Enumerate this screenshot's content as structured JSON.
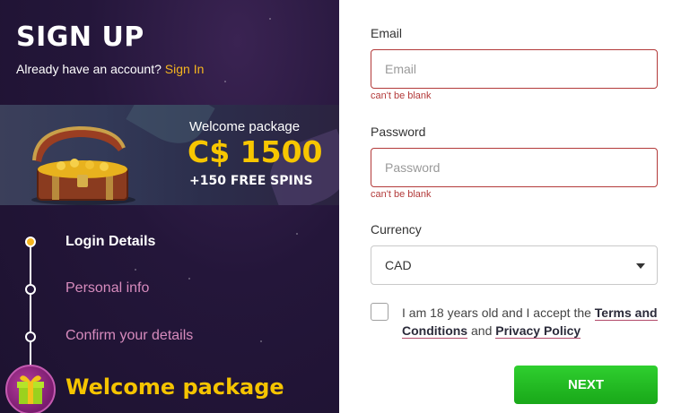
{
  "header": {
    "title": "SIGN UP",
    "have_account_text": "Already have an account?",
    "sign_in_link": "Sign In"
  },
  "banner": {
    "label": "Welcome package",
    "amount": "C$ 1500",
    "spins": "+150 FREE SPINS",
    "image_icon": "treasure-chest-icon"
  },
  "steps": [
    {
      "label": "Login Details",
      "state": "active"
    },
    {
      "label": "Personal info",
      "state": "pending"
    },
    {
      "label": "Confirm your details",
      "state": "pending"
    },
    {
      "label": "Welcome package",
      "state": "final",
      "icon": "gift-box-icon"
    }
  ],
  "form": {
    "email": {
      "label": "Email",
      "placeholder": "Email",
      "value": "",
      "error": "can't be blank"
    },
    "password": {
      "label": "Password",
      "placeholder": "Password",
      "value": "",
      "error": "can't be blank"
    },
    "currency": {
      "label": "Currency",
      "selected": "CAD"
    },
    "terms": {
      "checked": false,
      "text_before": "I am 18 years old and I accept the",
      "terms_link": "Terms and Conditions",
      "and_text": "and",
      "privacy_link": "Privacy Policy"
    },
    "next_button": "NEXT"
  },
  "colors": {
    "accent_yellow": "#f5b51f",
    "error_red": "#b33a3a",
    "next_green": "#19a819",
    "panel_purple": "#24163a",
    "step_pink": "#d78bbd"
  }
}
